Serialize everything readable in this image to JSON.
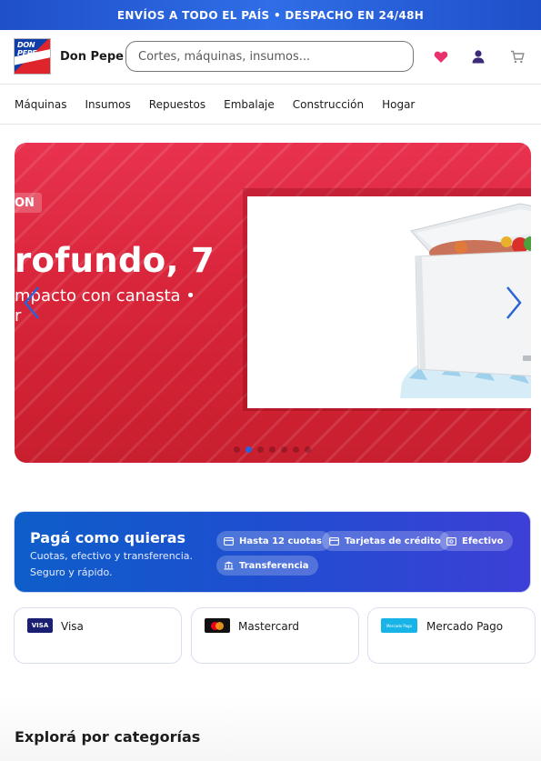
{
  "announcement": "ENVÍOS A TODO EL PAÍS • DESPACHO EN 24/48H",
  "header": {
    "logo_text": "DON PEPE",
    "brand_name": "Don Pepe",
    "search_placeholder": "Cortes, máquinas, insumos...",
    "icons": [
      "heart-icon",
      "user-icon",
      "cart-icon"
    ]
  },
  "nav": {
    "items": [
      "Máquinas",
      "Insumos",
      "Repuestos",
      "Embalaje",
      "Construcción",
      "Hogar"
    ]
  },
  "hero": {
    "badge": "ON",
    "headline": "rofundo, 7",
    "subline_1": "mpacto con canasta •",
    "subline_2": "r",
    "slide_count": 7,
    "active_slide": 2,
    "colors": {
      "background": "#d9253a",
      "dot_active": "#2a63d8"
    }
  },
  "payments": {
    "title": "Pagá como quieras",
    "description": "Cuotas, efectivo y transferencia. Seguro y rápido.",
    "chips": [
      {
        "icon": "card-icon",
        "label": "Hasta 12 cuotas"
      },
      {
        "icon": "credit-card-icon",
        "label": "Tarjetas de crédito"
      },
      {
        "icon": "cash-icon",
        "label": "Efectivo"
      },
      {
        "icon": "bank-icon",
        "label": "Transferencia"
      }
    ],
    "methods": [
      {
        "badge": "VISA",
        "label": "Visa",
        "color": "#1a1f71"
      },
      {
        "badge": "",
        "label": "Mastercard",
        "color": "#111111"
      },
      {
        "badge": "Mercado Pago",
        "label": "Mercado Pago",
        "color": "#18b4e8"
      }
    ]
  },
  "categories": {
    "title": "Explorá por categorías"
  }
}
